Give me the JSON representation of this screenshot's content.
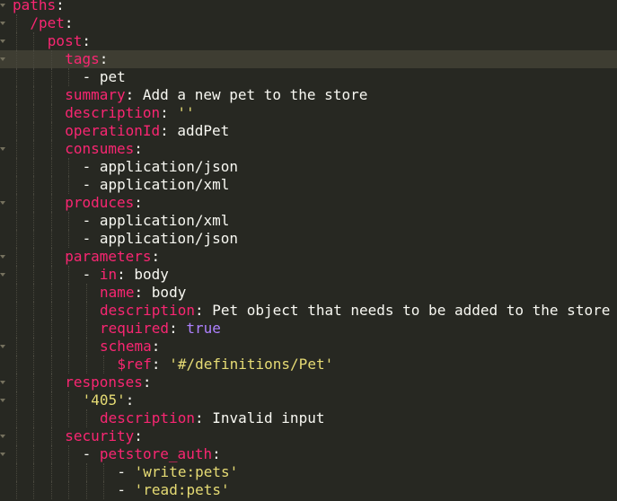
{
  "editor": {
    "theme": {
      "background": "#272822",
      "active_line": "#3e3d32",
      "key": "#f92672",
      "string": "#e6db74",
      "boolean": "#ae81ff",
      "text": "#f8f8f2"
    },
    "active_line": 3,
    "lines": [
      {
        "indent": 0,
        "fold": true,
        "tokens": [
          {
            "t": "paths",
            "c": "k"
          },
          {
            "t": ":",
            "c": "t"
          }
        ]
      },
      {
        "indent": 1,
        "fold": true,
        "tokens": [
          {
            "t": "/pet",
            "c": "k"
          },
          {
            "t": ":",
            "c": "t"
          }
        ]
      },
      {
        "indent": 2,
        "fold": true,
        "tokens": [
          {
            "t": "post",
            "c": "k"
          },
          {
            "t": ":",
            "c": "t"
          }
        ]
      },
      {
        "indent": 3,
        "fold": true,
        "tokens": [
          {
            "t": "tags",
            "c": "k"
          },
          {
            "t": ":",
            "c": "t"
          }
        ]
      },
      {
        "indent": 4,
        "fold": false,
        "tokens": [
          {
            "t": "- ",
            "c": "t"
          },
          {
            "t": "pet",
            "c": "t"
          }
        ]
      },
      {
        "indent": 3,
        "fold": false,
        "tokens": [
          {
            "t": "summary",
            "c": "k"
          },
          {
            "t": ": ",
            "c": "t"
          },
          {
            "t": "Add a new pet to the store",
            "c": "t"
          }
        ]
      },
      {
        "indent": 3,
        "fold": false,
        "tokens": [
          {
            "t": "description",
            "c": "k"
          },
          {
            "t": ": ",
            "c": "t"
          },
          {
            "t": "''",
            "c": "s"
          }
        ]
      },
      {
        "indent": 3,
        "fold": false,
        "tokens": [
          {
            "t": "operationId",
            "c": "k"
          },
          {
            "t": ": ",
            "c": "t"
          },
          {
            "t": "addPet",
            "c": "t"
          }
        ]
      },
      {
        "indent": 3,
        "fold": true,
        "tokens": [
          {
            "t": "consumes",
            "c": "k"
          },
          {
            "t": ":",
            "c": "t"
          }
        ]
      },
      {
        "indent": 4,
        "fold": false,
        "tokens": [
          {
            "t": "- ",
            "c": "t"
          },
          {
            "t": "application/json",
            "c": "t"
          }
        ]
      },
      {
        "indent": 4,
        "fold": false,
        "tokens": [
          {
            "t": "- ",
            "c": "t"
          },
          {
            "t": "application/xml",
            "c": "t"
          }
        ]
      },
      {
        "indent": 3,
        "fold": true,
        "tokens": [
          {
            "t": "produces",
            "c": "k"
          },
          {
            "t": ":",
            "c": "t"
          }
        ]
      },
      {
        "indent": 4,
        "fold": false,
        "tokens": [
          {
            "t": "- ",
            "c": "t"
          },
          {
            "t": "application/xml",
            "c": "t"
          }
        ]
      },
      {
        "indent": 4,
        "fold": false,
        "tokens": [
          {
            "t": "- ",
            "c": "t"
          },
          {
            "t": "application/json",
            "c": "t"
          }
        ]
      },
      {
        "indent": 3,
        "fold": true,
        "tokens": [
          {
            "t": "parameters",
            "c": "k"
          },
          {
            "t": ":",
            "c": "t"
          }
        ]
      },
      {
        "indent": 4,
        "fold": true,
        "tokens": [
          {
            "t": "- ",
            "c": "t"
          },
          {
            "t": "in",
            "c": "k"
          },
          {
            "t": ": ",
            "c": "t"
          },
          {
            "t": "body",
            "c": "t"
          }
        ]
      },
      {
        "indent": 5,
        "fold": false,
        "tokens": [
          {
            "t": "name",
            "c": "k"
          },
          {
            "t": ": ",
            "c": "t"
          },
          {
            "t": "body",
            "c": "t"
          }
        ]
      },
      {
        "indent": 5,
        "fold": false,
        "tokens": [
          {
            "t": "description",
            "c": "k"
          },
          {
            "t": ": ",
            "c": "t"
          },
          {
            "t": "Pet object that needs to be added to the store",
            "c": "t"
          }
        ]
      },
      {
        "indent": 5,
        "fold": false,
        "tokens": [
          {
            "t": "required",
            "c": "k"
          },
          {
            "t": ": ",
            "c": "t"
          },
          {
            "t": "true",
            "c": "b"
          }
        ]
      },
      {
        "indent": 5,
        "fold": true,
        "tokens": [
          {
            "t": "schema",
            "c": "k"
          },
          {
            "t": ":",
            "c": "t"
          }
        ]
      },
      {
        "indent": 6,
        "fold": false,
        "tokens": [
          {
            "t": "$ref",
            "c": "k"
          },
          {
            "t": ": ",
            "c": "t"
          },
          {
            "t": "'#/definitions/Pet'",
            "c": "s"
          }
        ]
      },
      {
        "indent": 3,
        "fold": true,
        "tokens": [
          {
            "t": "responses",
            "c": "k"
          },
          {
            "t": ":",
            "c": "t"
          }
        ]
      },
      {
        "indent": 4,
        "fold": true,
        "tokens": [
          {
            "t": "'405'",
            "c": "s"
          },
          {
            "t": ":",
            "c": "t"
          }
        ]
      },
      {
        "indent": 5,
        "fold": false,
        "tokens": [
          {
            "t": "description",
            "c": "k"
          },
          {
            "t": ": ",
            "c": "t"
          },
          {
            "t": "Invalid input",
            "c": "t"
          }
        ]
      },
      {
        "indent": 3,
        "fold": true,
        "tokens": [
          {
            "t": "security",
            "c": "k"
          },
          {
            "t": ":",
            "c": "t"
          }
        ]
      },
      {
        "indent": 4,
        "fold": true,
        "tokens": [
          {
            "t": "- ",
            "c": "t"
          },
          {
            "t": "petstore_auth",
            "c": "k"
          },
          {
            "t": ":",
            "c": "t"
          }
        ]
      },
      {
        "indent": 6,
        "fold": false,
        "tokens": [
          {
            "t": "- ",
            "c": "t"
          },
          {
            "t": "'write:pets'",
            "c": "s"
          }
        ]
      },
      {
        "indent": 6,
        "fold": false,
        "tokens": [
          {
            "t": "- ",
            "c": "t"
          },
          {
            "t": "'read:pets'",
            "c": "s"
          }
        ]
      }
    ]
  }
}
